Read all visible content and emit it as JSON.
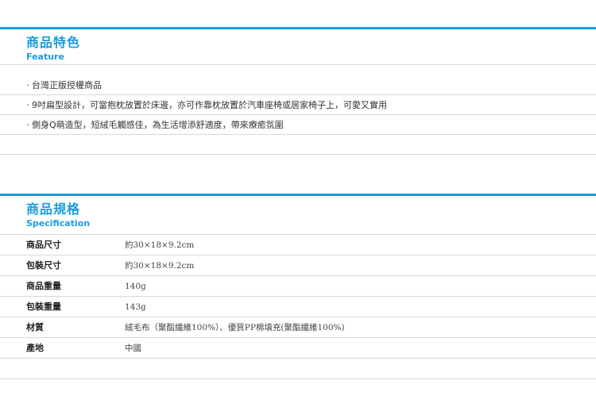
{
  "feature": {
    "title_zh": "商品特色",
    "title_en": "Feature",
    "items": [
      "台灣正版授權商品",
      "9吋扁型設計，可當抱枕放置於床邊，亦可作靠枕放置於汽車座椅或居家椅子上，可愛又實用",
      "側身Q萌造型，短絨毛觸感佳，為生活增添舒適度，帶來療癒氛圍"
    ],
    "bullet": "·"
  },
  "spec": {
    "title_zh": "商品規格",
    "title_en": "Specification",
    "rows": [
      {
        "label": "商品尺寸",
        "value": "約30×18×9.2cm"
      },
      {
        "label": "包裝尺寸",
        "value": "約30×18×9.2cm"
      },
      {
        "label": "商品重量",
        "value": "140g"
      },
      {
        "label": "包裝重量",
        "value": "143g"
      },
      {
        "label": "材質",
        "value": "絨毛布（聚酯纖維100%）、優質PP棉填充(聚酯纖維100%)"
      },
      {
        "label": "產地",
        "value": "中國"
      }
    ]
  },
  "colors": {
    "accent": "#1a9be0",
    "divider": "#d7d7d7"
  }
}
